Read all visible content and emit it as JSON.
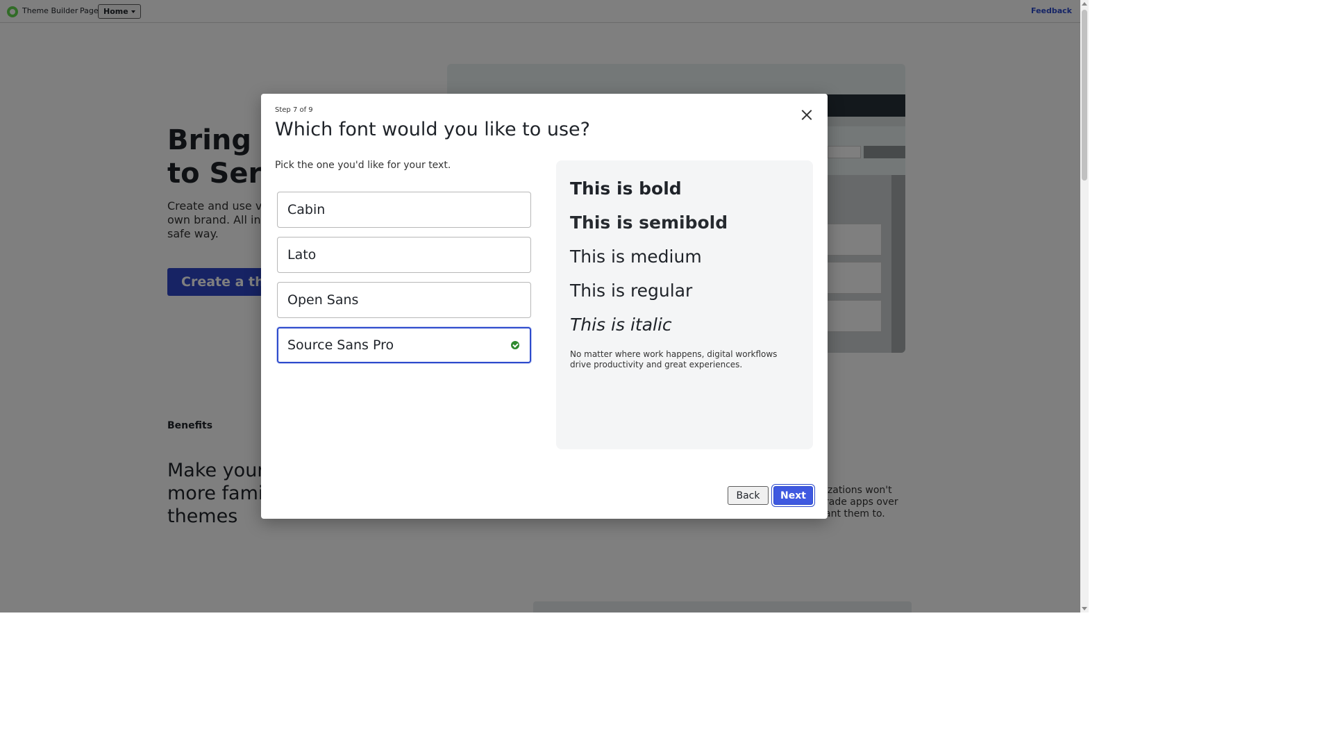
{
  "topbar": {
    "logo_icon": "theme-builder-logo",
    "app_title": "Theme Builder",
    "page_label": "Page:",
    "page_select_value": "Home",
    "feedback_label": "Feedback"
  },
  "background": {
    "hero_title": "Bring y to Serv",
    "hero_title_lines": [
      "Bring y",
      "to Serv"
    ],
    "hero_desc_lines": [
      "Create and use vis",
      "own brand. All in a",
      "safe way."
    ],
    "hero_cta": "Create a the",
    "benefits_label": "Benefits",
    "benefits_title_lines": [
      "Make your",
      "more famil",
      "themes"
    ],
    "benefits_right_lines": [
      "izations won't",
      "rade apps over",
      "ant them to."
    ]
  },
  "modal": {
    "step": "Step 7 of 9",
    "title": "Which font would you like to use?",
    "subtitle": "Pick the one you'd like for your text.",
    "font_options": [
      {
        "label": "Cabin",
        "selected": false
      },
      {
        "label": "Lato",
        "selected": false
      },
      {
        "label": "Open Sans",
        "selected": false
      },
      {
        "label": "Source Sans Pro",
        "selected": true
      }
    ],
    "preview": {
      "bold": "This is bold",
      "semibold": "This is semibold",
      "medium": "This is medium",
      "regular": "This is regular",
      "italic": "This is italic",
      "body": "No matter where work happens, digital workflows drive productivity and great experiences."
    },
    "back_label": "Back",
    "next_label": "Next"
  },
  "colors": {
    "accent": "#2d4bcc",
    "next_button": "#3f59e0",
    "selected_check": "#2e8a2e",
    "preview_bg": "#f4f5f6"
  }
}
